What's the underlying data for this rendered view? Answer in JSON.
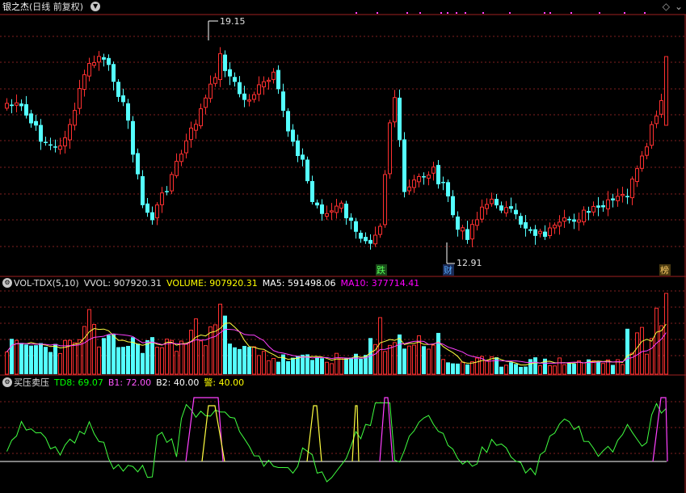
{
  "header": {
    "stock_name": "银之杰",
    "period": "(日线 前复权)",
    "menu_icon": "chevron-down-icon"
  },
  "corner": {
    "icon1": "diamond-icon",
    "icon2": "chevron-down-icon",
    "sym1": "◇",
    "sym2": "⌄"
  },
  "price_panel": {
    "high_label": "19.15",
    "low_label": "12.91",
    "markers": [
      "跌",
      "财",
      "榜"
    ]
  },
  "volume_panel": {
    "name": "VOL-TDX(5,10)",
    "vvol": "VVOL: 907920.31",
    "volume": "VOLUME: 907920.31",
    "ma5": "MA5: 591498.06",
    "ma10": "MA10: 377714.41"
  },
  "indicator_panel": {
    "name": "买压卖压",
    "td8": "TD8: 69.07",
    "b1": "B1: 72.00",
    "b2": "B2: 40.00",
    "warn": "警: 40.00"
  },
  "colors": {
    "up": "#ff3030",
    "down": "#54ffff",
    "grid": "#802020",
    "ma5": "#ffff40",
    "ma10": "#ff40ff",
    "td8": "#40ff40"
  }
}
